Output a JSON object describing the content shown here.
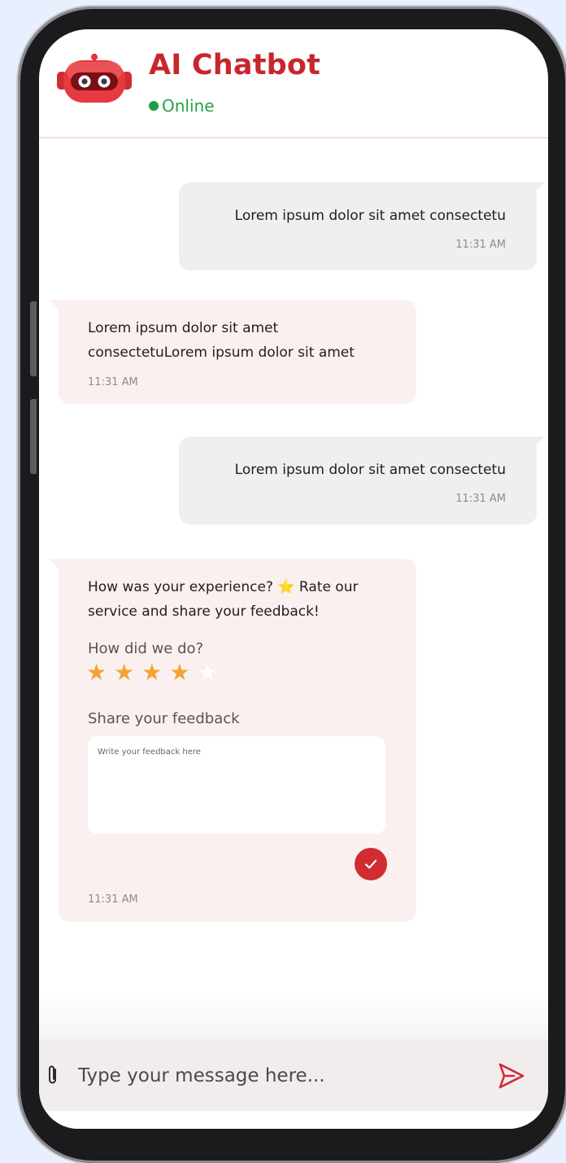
{
  "header": {
    "title": "AI Chatbot",
    "status": "Online",
    "avatar_icon": "robot-icon"
  },
  "messages": [
    {
      "direction": "outgoing",
      "text": "Lorem ipsum dolor sit amet consectetu",
      "time": "11:31 AM"
    },
    {
      "direction": "incoming",
      "lines": [
        "Lorem ipsum dolor sit amet",
        "consectetuLorem ipsum dolor sit amet"
      ],
      "time": "11:31 AM"
    },
    {
      "direction": "outgoing",
      "text": "Lorem ipsum dolor sit amet consectetu",
      "time": "11:31 AM"
    }
  ],
  "rating_card": {
    "prompt_line1": "How was your experience? ⭐ Rate our",
    "prompt_line2": "service and share your feedback!",
    "rating_label": "How did we do?",
    "rating": 4,
    "rating_max": 5,
    "feedback_label": "Share your feedback",
    "feedback_placeholder": "Write your feedback here",
    "submit_icon": "check-icon",
    "time": "11:31 AM"
  },
  "composer": {
    "placeholder": "Type your message here...",
    "attach_icon": "paperclip-icon",
    "send_icon": "send-icon"
  },
  "colors": {
    "accent": "#c8262c",
    "online": "#26a244",
    "star": "#f1a435",
    "incoming_bubble": "#fbf0f0",
    "outgoing_bubble": "#efefef"
  }
}
